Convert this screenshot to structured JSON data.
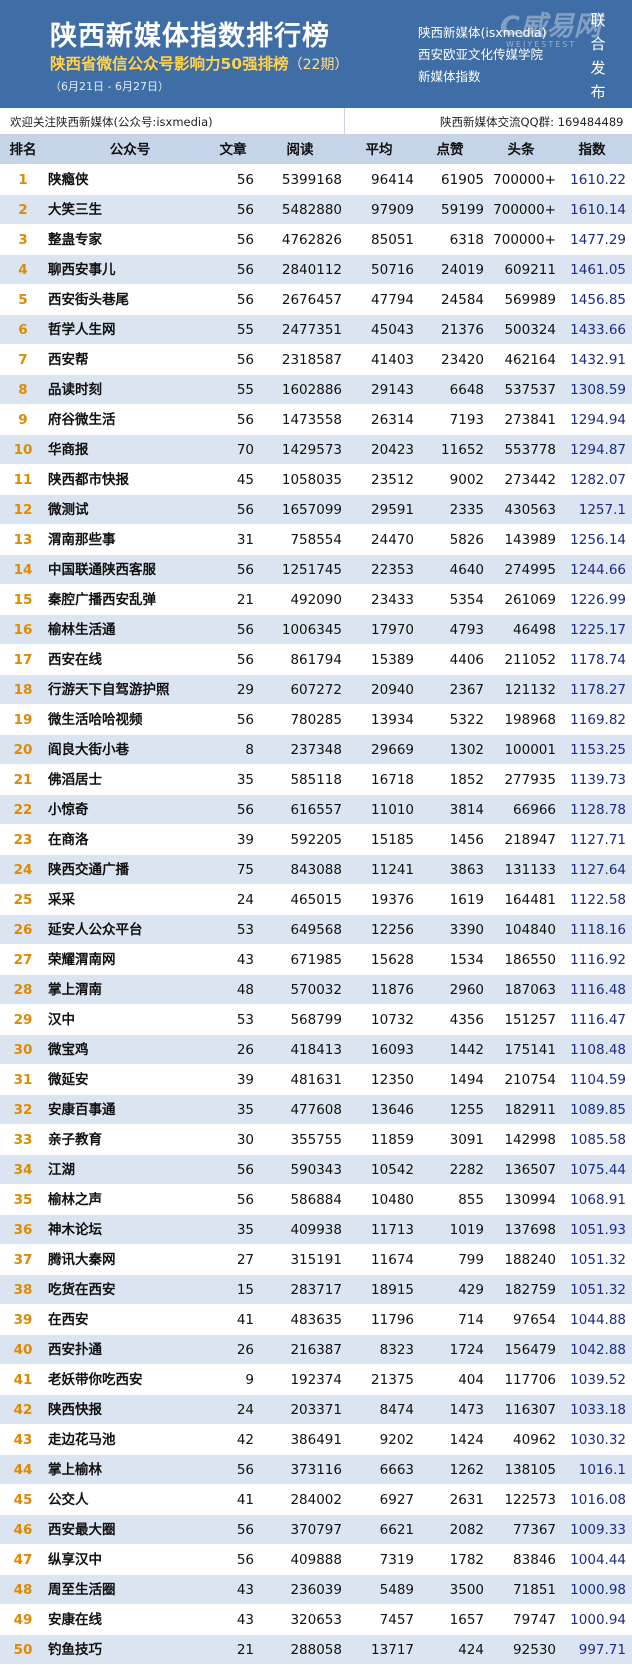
{
  "header": {
    "title": "陕西新媒体指数排行榜",
    "subtitle": "陕西省微信公众号影响力50强排榜",
    "issue": "（22期）",
    "date_range": "（6月21日 - 6月27日）",
    "org_lines": [
      "陕西新媒体(isxmedia)",
      "西安欧亚文化传媒学院",
      "新媒体指数"
    ],
    "logo_text": "C威易网",
    "logo_tag": "WEIYESTEST",
    "union_text": [
      "联",
      "合",
      "发",
      "布"
    ]
  },
  "notice": {
    "left": "欢迎关注陕西新媒体(公众号:isxmedia)",
    "right": "陕西新媒体交流QQ群: 169484489"
  },
  "table": {
    "columns": [
      "排名",
      "公众号",
      "文章",
      "阅读",
      "平均",
      "点赞",
      "头条",
      "指数"
    ],
    "rows": [
      [
        "1",
        "陕瘾侠",
        "56",
        "5399168",
        "96414",
        "61905",
        "700000+",
        "1610.22"
      ],
      [
        "2",
        "大笑三生",
        "56",
        "5482880",
        "97909",
        "59199",
        "700000+",
        "1610.14"
      ],
      [
        "3",
        "整蛊专家",
        "56",
        "4762826",
        "85051",
        "6318",
        "700000+",
        "1477.29"
      ],
      [
        "4",
        "聊西安事儿",
        "56",
        "2840112",
        "50716",
        "24019",
        "609211",
        "1461.05"
      ],
      [
        "5",
        "西安街头巷尾",
        "56",
        "2676457",
        "47794",
        "24584",
        "569989",
        "1456.85"
      ],
      [
        "6",
        "哲学人生网",
        "55",
        "2477351",
        "45043",
        "21376",
        "500324",
        "1433.66"
      ],
      [
        "7",
        "西安帮",
        "56",
        "2318587",
        "41403",
        "23420",
        "462164",
        "1432.91"
      ],
      [
        "8",
        "品读时刻",
        "55",
        "1602886",
        "29143",
        "6648",
        "537537",
        "1308.59"
      ],
      [
        "9",
        "府谷微生活",
        "56",
        "1473558",
        "26314",
        "7193",
        "273841",
        "1294.94"
      ],
      [
        "10",
        "华商报",
        "70",
        "1429573",
        "20423",
        "11652",
        "553778",
        "1294.87"
      ],
      [
        "11",
        "陕西都市快报",
        "45",
        "1058035",
        "23512",
        "9002",
        "273442",
        "1282.07"
      ],
      [
        "12",
        "微测试",
        "56",
        "1657099",
        "29591",
        "2335",
        "430563",
        "1257.1"
      ],
      [
        "13",
        "渭南那些事",
        "31",
        "758554",
        "24470",
        "5826",
        "143989",
        "1256.14"
      ],
      [
        "14",
        "中国联通陕西客服",
        "56",
        "1251745",
        "22353",
        "4640",
        "274995",
        "1244.66"
      ],
      [
        "15",
        "秦腔广播西安乱弹",
        "21",
        "492090",
        "23433",
        "5354",
        "261069",
        "1226.99"
      ],
      [
        "16",
        "榆林生活通",
        "56",
        "1006345",
        "17970",
        "4793",
        "46498",
        "1225.17"
      ],
      [
        "17",
        "西安在线",
        "56",
        "861794",
        "15389",
        "4406",
        "211052",
        "1178.74"
      ],
      [
        "18",
        "行游天下自驾游护照",
        "29",
        "607272",
        "20940",
        "2367",
        "121132",
        "1178.27"
      ],
      [
        "19",
        "微生活哈哈视频",
        "56",
        "780285",
        "13934",
        "5322",
        "198968",
        "1169.82"
      ],
      [
        "20",
        "阎良大街小巷",
        "8",
        "237348",
        "29669",
        "1302",
        "100001",
        "1153.25"
      ],
      [
        "21",
        "佛滔居士",
        "35",
        "585118",
        "16718",
        "1852",
        "277935",
        "1139.73"
      ],
      [
        "22",
        "小惊奇",
        "56",
        "616557",
        "11010",
        "3814",
        "66966",
        "1128.78"
      ],
      [
        "23",
        "在商洛",
        "39",
        "592205",
        "15185",
        "1456",
        "218947",
        "1127.71"
      ],
      [
        "24",
        "陕西交通广播",
        "75",
        "843088",
        "11241",
        "3863",
        "131133",
        "1127.64"
      ],
      [
        "25",
        "采采",
        "24",
        "465015",
        "19376",
        "1619",
        "164481",
        "1122.58"
      ],
      [
        "26",
        "延安人公众平台",
        "53",
        "649568",
        "12256",
        "3390",
        "104840",
        "1118.16"
      ],
      [
        "27",
        "荣耀渭南网",
        "43",
        "671985",
        "15628",
        "1534",
        "186550",
        "1116.92"
      ],
      [
        "28",
        "掌上渭南",
        "48",
        "570032",
        "11876",
        "2960",
        "187063",
        "1116.48"
      ],
      [
        "29",
        "汉中",
        "53",
        "568799",
        "10732",
        "4356",
        "151257",
        "1116.47"
      ],
      [
        "30",
        "微宝鸡",
        "26",
        "418413",
        "16093",
        "1442",
        "175141",
        "1108.48"
      ],
      [
        "31",
        "微延安",
        "39",
        "481631",
        "12350",
        "1494",
        "210754",
        "1104.59"
      ],
      [
        "32",
        "安康百事通",
        "35",
        "477608",
        "13646",
        "1255",
        "182911",
        "1089.85"
      ],
      [
        "33",
        "亲子教育",
        "30",
        "355755",
        "11859",
        "3091",
        "142998",
        "1085.58"
      ],
      [
        "34",
        "江湖",
        "56",
        "590343",
        "10542",
        "2282",
        "136507",
        "1075.44"
      ],
      [
        "35",
        "榆林之声",
        "56",
        "586884",
        "10480",
        "855",
        "130994",
        "1068.91"
      ],
      [
        "36",
        "神木论坛",
        "35",
        "409938",
        "11713",
        "1019",
        "137698",
        "1051.93"
      ],
      [
        "37",
        "腾讯大秦网",
        "27",
        "315191",
        "11674",
        "799",
        "188240",
        "1051.32"
      ],
      [
        "38",
        "吃货在西安",
        "15",
        "283717",
        "18915",
        "429",
        "182759",
        "1051.32"
      ],
      [
        "39",
        "在西安",
        "41",
        "483635",
        "11796",
        "714",
        "97654",
        "1044.88"
      ],
      [
        "40",
        "西安扑通",
        "26",
        "216387",
        "8323",
        "1724",
        "156479",
        "1042.88"
      ],
      [
        "41",
        "老妖带你吃西安",
        "9",
        "192374",
        "21375",
        "404",
        "117706",
        "1039.52"
      ],
      [
        "42",
        "陕西快报",
        "24",
        "203371",
        "8474",
        "1473",
        "116307",
        "1033.18"
      ],
      [
        "43",
        "走边花马池",
        "42",
        "386491",
        "9202",
        "1424",
        "40962",
        "1030.32"
      ],
      [
        "44",
        "掌上榆林",
        "56",
        "373116",
        "6663",
        "1262",
        "138105",
        "1016.1"
      ],
      [
        "45",
        "公交人",
        "41",
        "284002",
        "6927",
        "2631",
        "122573",
        "1016.08"
      ],
      [
        "46",
        "西安最大圈",
        "56",
        "370797",
        "6621",
        "2082",
        "77367",
        "1009.33"
      ],
      [
        "47",
        "纵享汉中",
        "56",
        "409888",
        "7319",
        "1782",
        "83846",
        "1004.44"
      ],
      [
        "48",
        "周至生活圈",
        "43",
        "236039",
        "5489",
        "3500",
        "71851",
        "1000.98"
      ],
      [
        "49",
        "安康在线",
        "43",
        "320653",
        "7457",
        "1657",
        "79747",
        "1000.94"
      ],
      [
        "50",
        "钓鱼技巧",
        "21",
        "288058",
        "13717",
        "424",
        "92530",
        "997.71"
      ]
    ]
  }
}
